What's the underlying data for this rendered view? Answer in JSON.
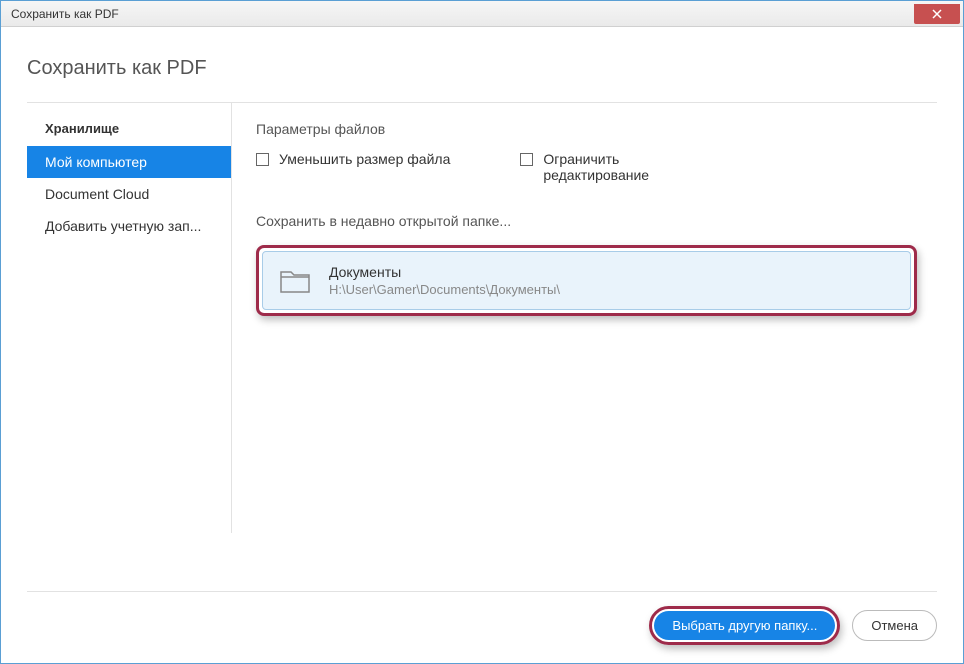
{
  "window": {
    "title": "Сохранить как PDF"
  },
  "page": {
    "title": "Сохранить как PDF"
  },
  "sidebar": {
    "heading": "Хранилище",
    "items": [
      {
        "label": "Мой компьютер",
        "active": true
      },
      {
        "label": "Document Cloud",
        "active": false
      },
      {
        "label": "Добавить учетную зап...",
        "active": false
      }
    ]
  },
  "content": {
    "params_title": "Параметры файлов",
    "checkboxes": [
      {
        "label": "Уменьшить размер файла",
        "checked": false
      },
      {
        "label": "Ограничить редактирование",
        "checked": false
      }
    ],
    "recent_title": "Сохранить в недавно открытой папке...",
    "folder": {
      "name": "Документы",
      "path": "H:\\User\\Gamer\\Documents\\Документы\\"
    }
  },
  "footer": {
    "primary": "Выбрать другую папку...",
    "cancel": "Отмена"
  }
}
